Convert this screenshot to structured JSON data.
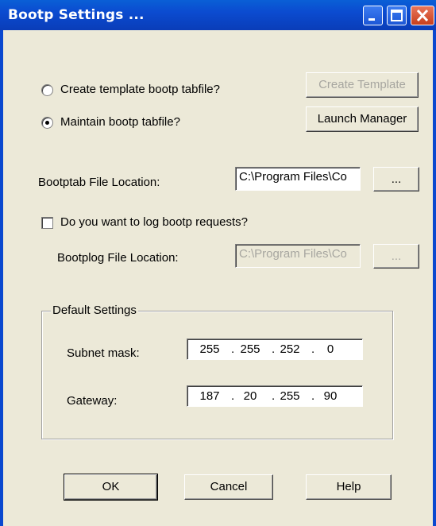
{
  "window": {
    "title": "Bootp Settings ..."
  },
  "options": {
    "create_template_label": "Create template bootp tabfile?",
    "maintain_label": "Maintain bootp tabfile?",
    "create_template_button": "Create Template",
    "launch_manager_button": "Launch Manager",
    "selected": "maintain"
  },
  "bootptab": {
    "label": "Bootptab File Location:",
    "value": "C:\\Program Files\\Co",
    "browse": "..."
  },
  "logging": {
    "checkbox_label": "Do you want to log bootp requests?",
    "checked": false,
    "bootplog_label": "Bootplog File Location:",
    "bootplog_value": "C:\\Program Files\\Co",
    "browse": "..."
  },
  "defaults": {
    "title": "Default Settings",
    "subnet_label": "Subnet mask:",
    "subnet": [
      "255",
      "255",
      "252",
      "0"
    ],
    "gateway_label": "Gateway:",
    "gateway": [
      "187",
      "20",
      "255",
      "90"
    ]
  },
  "buttons": {
    "ok": "OK",
    "cancel": "Cancel",
    "help": "Help"
  }
}
